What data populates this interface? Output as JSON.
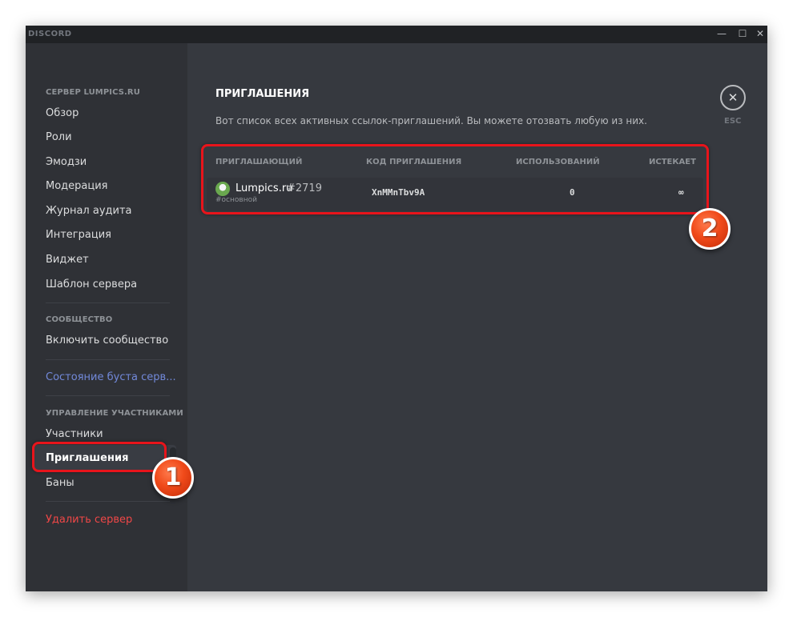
{
  "window": {
    "brand": "DISCORD",
    "controls": {
      "minimize": "—",
      "maximize": "☐",
      "close": "✕"
    }
  },
  "sidebar": {
    "server_section": "СЕРВЕР LUMPICS.RU",
    "server_items": [
      "Обзор",
      "Роли",
      "Эмодзи",
      "Модерация",
      "Журнал аудита",
      "Интеграция",
      "Виджет",
      "Шаблон сервера"
    ],
    "community_section": "СООБЩЕСТВО",
    "community_items": [
      "Включить сообщество"
    ],
    "boost_item": "Состояние буста серв...",
    "members_section": "УПРАВЛЕНИЕ УЧАСТНИКАМИ",
    "members_items": [
      "Участники",
      "Приглашения",
      "Баны"
    ],
    "delete_item": "Удалить сервер"
  },
  "content": {
    "title": "ПРИГЛАШЕНИЯ",
    "description": "Вот список всех активных ссылок-приглашений. Вы можете отозвать любую из них.",
    "esc_icon": "✕",
    "esc_label": "ESC",
    "columns": {
      "inviter": "ПРИГЛАШАЮЩИЙ",
      "code": "КОД ПРИГЛАШЕНИЯ",
      "uses": "ИСПОЛЬЗОВАНИЙ",
      "expires": "ИСТЕКАЕТ"
    },
    "invite": {
      "username": "Lumpics.ru",
      "discriminator": "#2719",
      "channel": "#основной",
      "code": "XnMMnTbv9A",
      "uses": "0",
      "expires": "∞"
    }
  },
  "annotations": {
    "badge1": "1",
    "badge2": "2",
    "highlight_color": "#e8141b"
  },
  "colors": {
    "sidebar_bg": "#2f3136",
    "content_bg": "#36393f",
    "titlebar_bg": "#202225",
    "boost": "#7289da",
    "danger": "#f04747"
  }
}
